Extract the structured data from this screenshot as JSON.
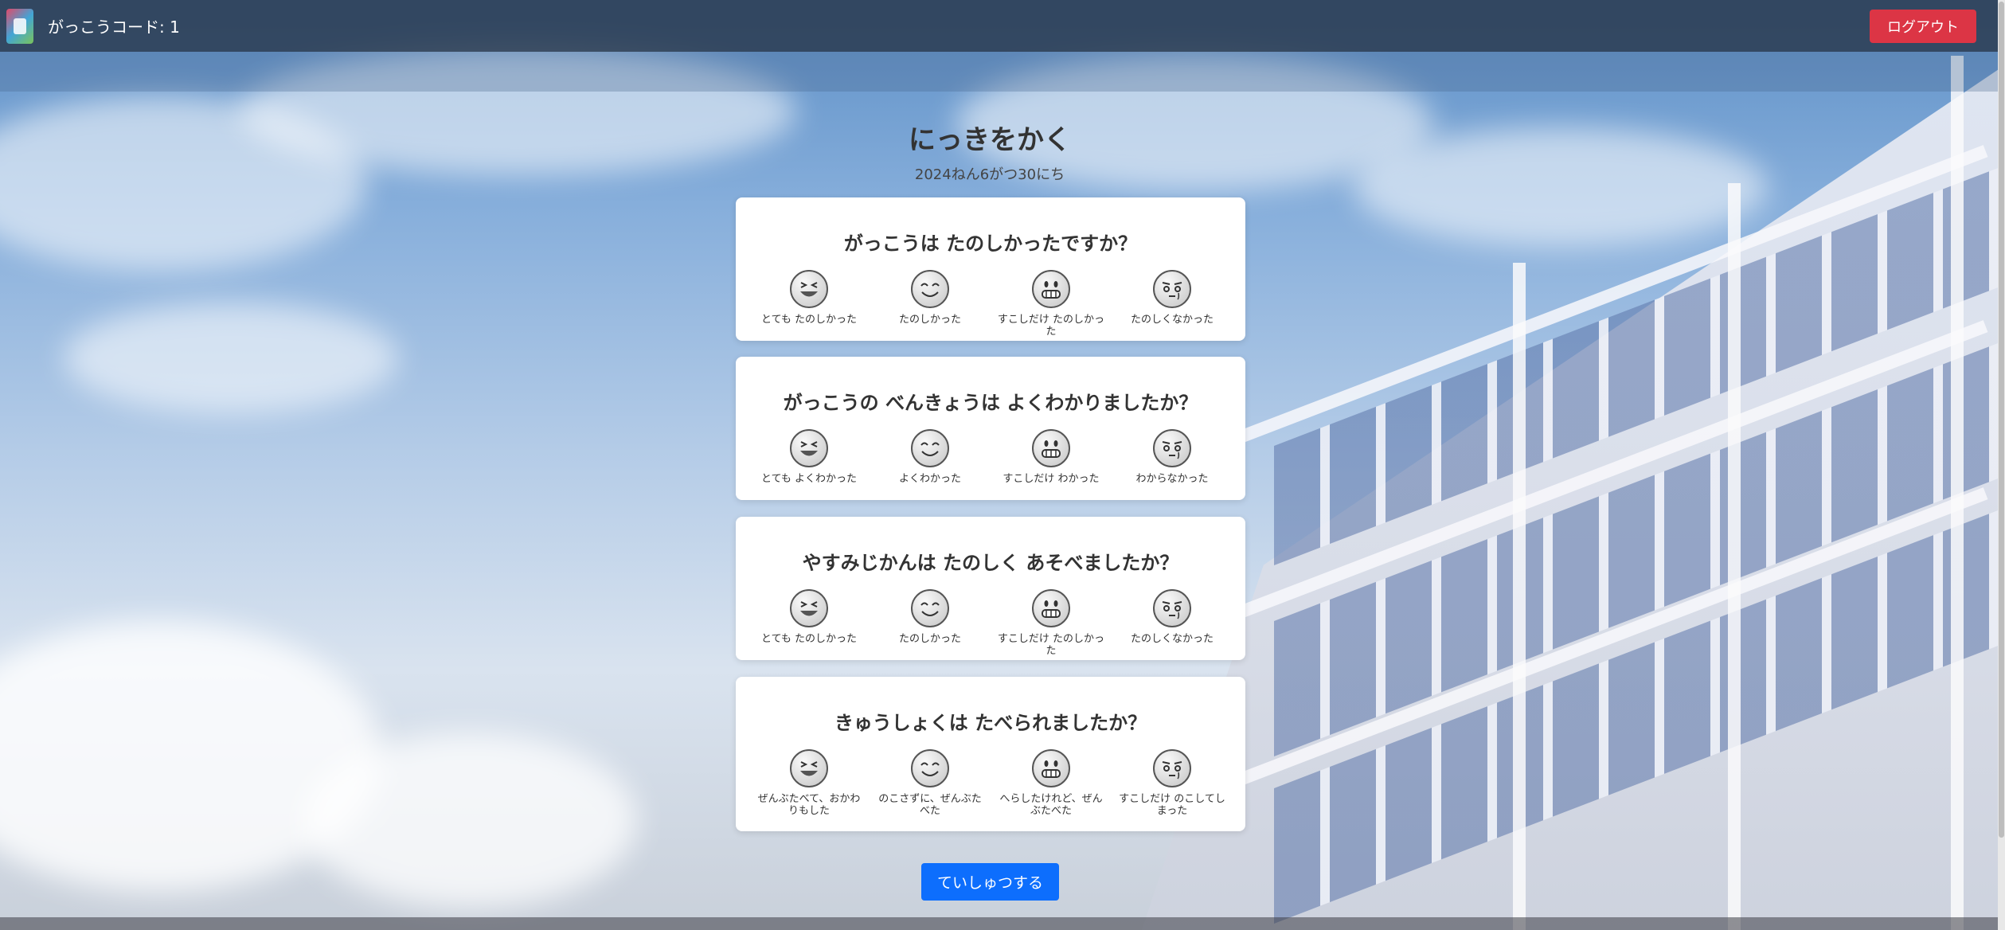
{
  "header": {
    "school_code": "がっこうコード: 1",
    "logout_label": "ログアウト"
  },
  "page": {
    "title": "にっきをかく",
    "date": "2024ねん6がつ30にち"
  },
  "questions": [
    {
      "title": "がっこうは たのしかったですか？",
      "options": [
        "とても たのしかった",
        "たのしかった",
        "すこしだけ たのしかった",
        "たのしくなかった"
      ]
    },
    {
      "title": "がっこうの べんきょうは よくわかりましたか？",
      "options": [
        "とても よくわかった",
        "よくわかった",
        "すこしだけ わかった",
        "わからなかった"
      ]
    },
    {
      "title": "やすみじかんは たのしく あそべましたか？",
      "options": [
        "とても たのしかった",
        "たのしかった",
        "すこしだけ たのしかった",
        "たのしくなかった"
      ]
    },
    {
      "title": "きゅうしょくは たべられましたか？",
      "options": [
        "ぜんぶたべて、おかわりもした",
        "のこさずに、ぜんぶたべた",
        "へらしたけれど、ぜんぶたべた",
        "すこしだけ のこしてしまった"
      ]
    }
  ],
  "icons": [
    "very-happy-face-icon",
    "happy-face-icon",
    "grin-face-icon",
    "sad-face-icon"
  ],
  "submit_label": "ていしゅつする",
  "colors": {
    "logout": "#dc3545",
    "submit": "#0d6efd",
    "header": "#28374b"
  }
}
